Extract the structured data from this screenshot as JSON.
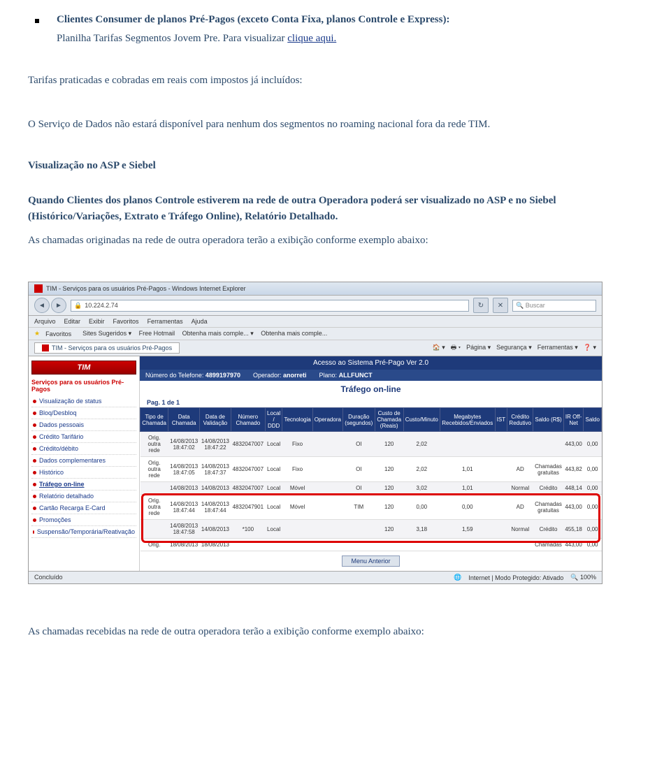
{
  "bullet_heading": "Clientes Consumer de planos Pré-Pagos (exceto  Conta Fixa, planos Controle e Express):",
  "subline_prefix": "Planilha Tarifas Segmentos Jovem Pre. Para visualizar ",
  "subline_link": "clique aqui.",
  "para_tarifas_1": "Tarifas praticadas e cobradas em reais com impostos já incluídos:",
  "para_tarifas_2": "O Serviço de Dados não estará disponível para nenhum dos segmentos no roaming nacional fora da rede TIM.",
  "section_title": "Visualização no ASP e Siebel",
  "bold_para": "Quando Clientes dos planos Controle estiverem na rede de outra Operadora poderá ser visualizado no ASP e no Siebel (Histórico/Variações, Extrato e Tráfego Online), Relatório Detalhado.",
  "originadas_para": "As chamadas originadas na rede de outra operadora terão a exibição conforme exemplo abaixo:",
  "recebidas_para": "As chamadas recebidas na rede de outra operadora terão a exibição conforme exemplo abaixo:",
  "screenshot": {
    "ie_title": "TIM - Serviços para os usuários Pré-Pagos - Windows Internet Explorer",
    "url": "10.224.2.74",
    "search_placeholder": "Buscar",
    "menu": [
      "Arquivo",
      "Editar",
      "Exibir",
      "Favoritos",
      "Ferramentas",
      "Ajuda"
    ],
    "fav_label": "Favoritos",
    "fav_items": [
      "Sites Sugeridos ▾",
      "Free Hotmail",
      "Obtenha mais comple... ▾",
      "Obtenha mais comple..."
    ],
    "tab_title": "TIM - Serviços para os usuários Pré-Pagos",
    "right_tools": [
      "🏠 ▾",
      "🖶 ▾",
      "Página ▾",
      "Segurança ▾",
      "Ferramentas ▾",
      "❓ ▾"
    ],
    "logo": "TIM",
    "sidebar_header": "Serviços para os usuários Pré-Pagos",
    "sidebar_items": [
      "Visualização de status",
      "Bloq/Desbloq",
      "Dados pessoais",
      "Crédito Tarifário",
      "Crédito/débito",
      "Dados complementares",
      "Histórico",
      "Tráfego on-line",
      "Relatório detalhado",
      "Cartão Recarga E-Card",
      "Promoções",
      "Suspensão/Temporária/Reativação"
    ],
    "active_index": 7,
    "blue_header": "Acesso ao Sistema Pré-Pago    Ver  2.0",
    "info_row": {
      "tel_label": "Número do Telefone:",
      "tel": "4899197970",
      "op_label": "Operador:",
      "op": "anorreti",
      "plano_label": "Plano:",
      "plano": "ALLFUNCT"
    },
    "trafego_title": "Tráfego on-line",
    "pag": "Pag. 1 de 1",
    "headers": [
      "Tipo de Chamada",
      "Data Chamada",
      "Data de Validação",
      "Número Chamado",
      "Local / DDD",
      "Tecnologia",
      "Operadora",
      "Duração (segundos)",
      "Custo de Chamada (Reais)",
      "Custo/Minuto",
      "Megabytes Recebidos/Enviados",
      "IST",
      "Crédito Redutivo",
      "Saldo (R$)",
      "IR Off-Net",
      "Saldo"
    ],
    "rows": [
      {
        "cells": [
          "Orig. outra rede",
          "14/08/2013 18:47:02",
          "14/08/2013 18:47:22",
          "4832047007",
          "Local",
          "Fixo",
          "",
          "OI",
          "120",
          "2,02",
          "",
          "",
          "",
          "",
          "443,00",
          "0,00"
        ]
      },
      {
        "cells": [
          "Orig. outra rede",
          "14/08/2013 18:47:05",
          "14/08/2013 18:47:37",
          "4832047007",
          "Local",
          "Fixo",
          "",
          "OI",
          "120",
          "2,02",
          "1,01",
          "",
          "AD",
          "Chamadas gratuitas",
          "443,82",
          "0,00"
        ]
      },
      {
        "cells": [
          "",
          "14/08/2013",
          "14/08/2013",
          "4832047007",
          "Local",
          "Móvel",
          "",
          "OI",
          "120",
          "3,02",
          "1,01",
          "",
          "Normal",
          "Crédito",
          "448,14",
          "0,00"
        ]
      },
      {
        "cells": [
          "Orig. outra rede",
          "14/08/2013 18:47:44",
          "14/08/2013 18:47:44",
          "4832047901",
          "Local",
          "Móvel",
          "",
          "TIM",
          "120",
          "0,00",
          "0,00",
          "",
          "AD",
          "Chamadas gratuitas",
          "443,00",
          "0,00"
        ]
      },
      {
        "cells": [
          "",
          "14/08/2013 18:47:58",
          "14/08/2013",
          "*100",
          "Local",
          "",
          "",
          "",
          "120",
          "3,18",
          "1,59",
          "",
          "Normal",
          "Crédito",
          "455,18",
          "0,00"
        ]
      },
      {
        "cells": [
          "Orig.",
          "18/08/2013",
          "18/08/2013",
          "",
          "",
          "",
          "",
          "",
          "",
          "",
          "",
          "",
          "",
          "Chamadas",
          "443,00",
          "0,00"
        ]
      }
    ],
    "highlight_rows": [
      3,
      4
    ],
    "menu_anterior": "Menu Anterior",
    "status_left": "Concluído",
    "status_mid": "Internet | Modo Protegido: Ativado",
    "status_zoom": "🔍 100%"
  }
}
